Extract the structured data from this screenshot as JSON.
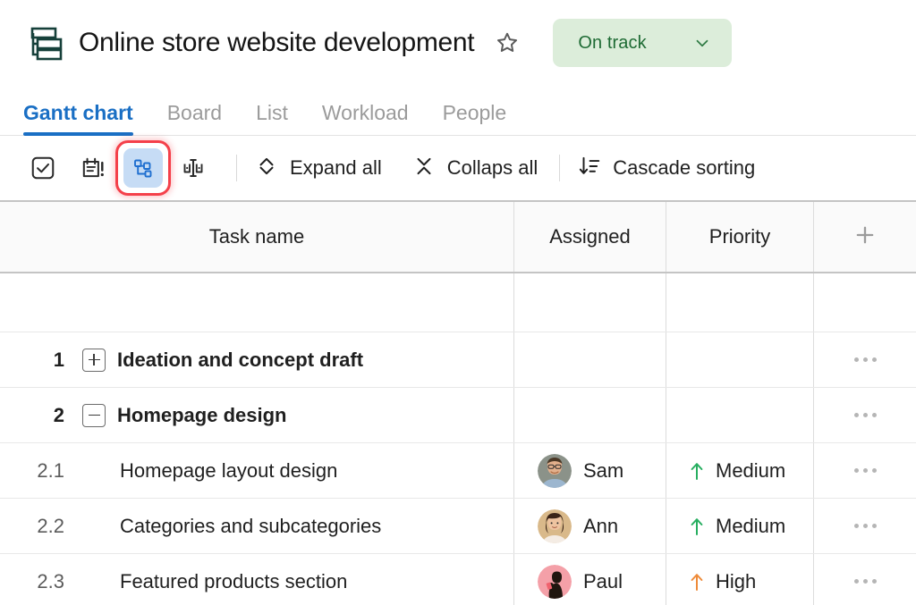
{
  "header": {
    "project_icon": "gantt-hierarchy-icon",
    "title": "Online store website development",
    "favorite_icon": "star-outline-icon",
    "status": {
      "label": "On track",
      "chevron_icon": "chevron-down-icon",
      "bg_color": "#dcedda",
      "text_color": "#1e6b34"
    }
  },
  "tabs": [
    {
      "label": "Gantt chart",
      "active": true
    },
    {
      "label": "Board",
      "active": false
    },
    {
      "label": "List",
      "active": false
    },
    {
      "label": "Workload",
      "active": false
    },
    {
      "label": "People",
      "active": false
    }
  ],
  "tab_accent_color": "#1a6fc4",
  "toolbar": {
    "icon_buttons": [
      {
        "name": "checkbox-check-icon",
        "active": false,
        "highlighted": false
      },
      {
        "name": "calendar-alert-icon",
        "active": false,
        "highlighted": false
      },
      {
        "name": "hierarchy-structure-icon",
        "active": true,
        "highlighted": true
      },
      {
        "name": "baseline-compare-icon",
        "active": false,
        "highlighted": false
      }
    ],
    "highlight_color": "#f4404a",
    "actions": [
      {
        "label": "Expand all",
        "icon": "chevron-expand-icon"
      },
      {
        "label": "Collaps all",
        "icon": "chevron-collapse-icon"
      },
      {
        "label": "Cascade sorting",
        "icon": "sort-descending-icon"
      }
    ]
  },
  "table": {
    "columns": [
      {
        "key": "task",
        "label": "Task name"
      },
      {
        "key": "assigned",
        "label": "Assigned"
      },
      {
        "key": "priority",
        "label": "Priority"
      },
      {
        "key": "add",
        "label": "+",
        "icon": "plus-icon"
      }
    ],
    "rows": [
      {
        "wbs": "1",
        "name": "Ideation and concept draft",
        "level": "parent",
        "toggle": "plus",
        "assigned": "",
        "avatar": "",
        "priority": "",
        "priority_color": "",
        "menu_icon": "more-horizontal-icon"
      },
      {
        "wbs": "2",
        "name": "Homepage design",
        "level": "parent",
        "toggle": "minus",
        "assigned": "",
        "avatar": "",
        "priority": "",
        "priority_color": "",
        "menu_icon": "more-horizontal-icon"
      },
      {
        "wbs": "2.1",
        "name": "Homepage layout design",
        "level": "child",
        "toggle": "",
        "assigned": "Sam",
        "avatar": "sam-avatar",
        "priority": "Medium",
        "priority_color": "#27ae60",
        "menu_icon": "more-horizontal-icon"
      },
      {
        "wbs": "2.2",
        "name": "Categories and subcategories",
        "level": "child",
        "toggle": "",
        "assigned": "Ann",
        "avatar": "ann-avatar",
        "priority": "Medium",
        "priority_color": "#27ae60",
        "menu_icon": "more-horizontal-icon"
      },
      {
        "wbs": "2.3",
        "name": "Featured products section",
        "level": "child",
        "toggle": "",
        "assigned": "Paul",
        "avatar": "paul-avatar",
        "priority": "High",
        "priority_color": "#ee8b3a",
        "menu_icon": "more-horizontal-icon"
      }
    ]
  }
}
